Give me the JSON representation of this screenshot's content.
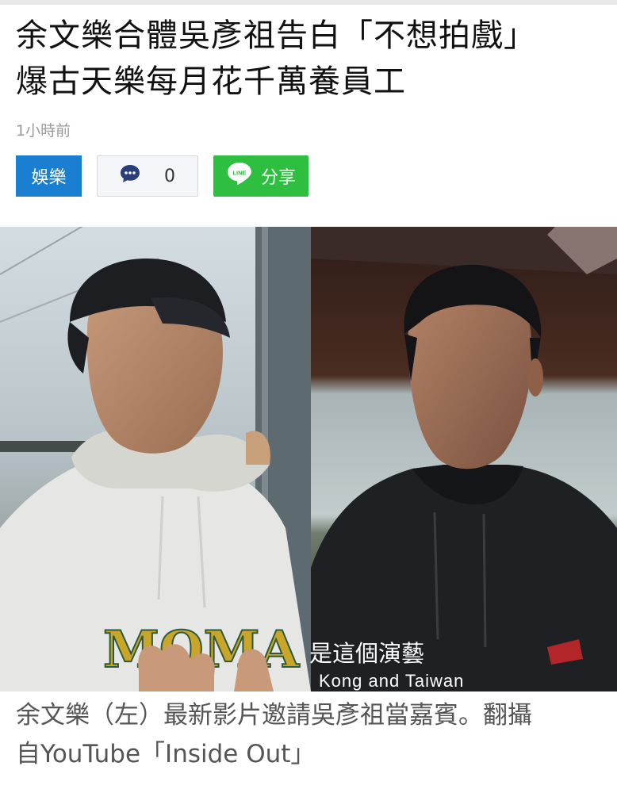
{
  "article": {
    "headline_line1": "余文樂合體吳彥祖告白「不想拍戲」",
    "headline_line2": "爆古天樂每月花千萬養員工",
    "time": "1小時前"
  },
  "actions": {
    "category_label": "娛樂",
    "comment_count": "0",
    "share_label": "分享",
    "line_logo_text": "LINE"
  },
  "image": {
    "subtitle_zh": "是這個演藝",
    "subtitle_en": "Kong and Taiwan",
    "hoodie_text": "MOMA"
  },
  "caption": {
    "line1": "余文樂（左）最新影片邀請吳彥祖當嘉賓。翻攝",
    "line2": "自YouTube「Inside Out」"
  },
  "colors": {
    "category_bg": "#1a7fd0",
    "share_bg": "#2fbf40",
    "comment_icon": "#2a3f7a"
  },
  "icons": {
    "comment": "comment-bubble-icon",
    "share": "line-logo-icon"
  }
}
